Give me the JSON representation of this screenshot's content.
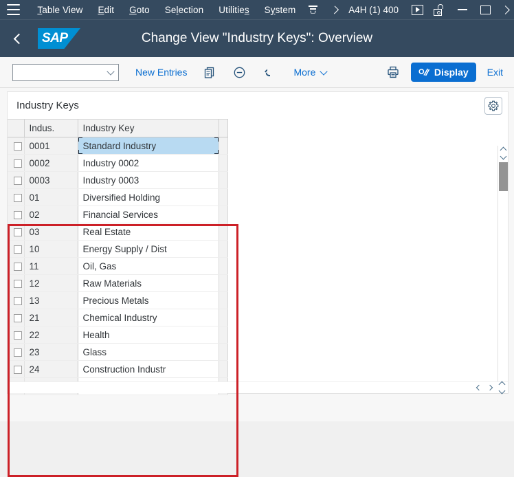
{
  "menubar": {
    "hamburger_icon": "hamburger-icon",
    "items": [
      {
        "label": "Table View",
        "accesskey": "T"
      },
      {
        "label": "Edit",
        "accesskey": "E"
      },
      {
        "label": "Goto",
        "accesskey": "G"
      },
      {
        "label": "Selection",
        "accesskey": "l"
      },
      {
        "label": "Utilities",
        "accesskey": "s"
      },
      {
        "label": "System",
        "accesskey": "y"
      }
    ],
    "overflow_icon": "menu-overflow-icon",
    "forward_icon": "chevron-right-icon",
    "system_id": "A4H (1) 400",
    "window_controls": [
      {
        "icon": "play-in-box-icon"
      },
      {
        "icon": "unlocked-padlock-icon"
      },
      {
        "icon": "minimize-icon"
      },
      {
        "icon": "maximize-icon"
      },
      {
        "icon": "chevron-right-icon"
      }
    ]
  },
  "shellbar": {
    "back_icon": "back-chevron-icon",
    "logo_text": "SAP",
    "title": "Change View \"Industry Keys\": Overview"
  },
  "toolbar": {
    "combo_value": "",
    "combo_placeholder": "",
    "combo_icon": "chevron-down-icon",
    "new_entries_label": "New Entries",
    "copy_icon": "copy-document-icon",
    "delete_icon": "minus-circle-icon",
    "undo_icon": "undo-arrow-icon",
    "more_label": "More",
    "more_icon": "chevron-down-icon",
    "print_icon": "printer-icon",
    "display_label": "Display",
    "display_icon": "display-pencil-icon",
    "display_color": "#0a6ed1",
    "exit_label": "Exit"
  },
  "panel": {
    "title": "Industry Keys",
    "settings_icon": "gear-icon"
  },
  "table": {
    "columns": [
      "",
      "Indus.",
      "Industry Key",
      ""
    ],
    "selected_row_index": 0,
    "selection_color": "#b8daf2",
    "rows": [
      {
        "checked": false,
        "key": "0001",
        "name": "Standard Industry"
      },
      {
        "checked": false,
        "key": "0002",
        "name": "Industry 0002"
      },
      {
        "checked": false,
        "key": "0003",
        "name": "Industry 0003"
      },
      {
        "checked": false,
        "key": "01",
        "name": "Diversified Holding"
      },
      {
        "checked": false,
        "key": "02",
        "name": "Financial Services"
      },
      {
        "checked": false,
        "key": "03",
        "name": "Real Estate"
      },
      {
        "checked": false,
        "key": "10",
        "name": "Energy Supply / Dist"
      },
      {
        "checked": false,
        "key": "11",
        "name": "Oil, Gas"
      },
      {
        "checked": false,
        "key": "12",
        "name": "Raw Materials"
      },
      {
        "checked": false,
        "key": "13",
        "name": "Precious Metals"
      },
      {
        "checked": false,
        "key": "21",
        "name": "Chemical Industry"
      },
      {
        "checked": false,
        "key": "22",
        "name": "Health"
      },
      {
        "checked": false,
        "key": "23",
        "name": "Glass"
      },
      {
        "checked": false,
        "key": "24",
        "name": "Construction Industr"
      },
      {
        "checked": false,
        "key": "",
        "name": ""
      }
    ]
  },
  "scrollbars": {
    "vertical_up_icon": "caret-up-icon",
    "vertical_down_icon": "caret-down-icon",
    "nav_prev_icon": "chevron-left-icon",
    "nav_next_icon": "chevron-right-icon"
  },
  "annotation": {
    "color": "#cc2027"
  }
}
